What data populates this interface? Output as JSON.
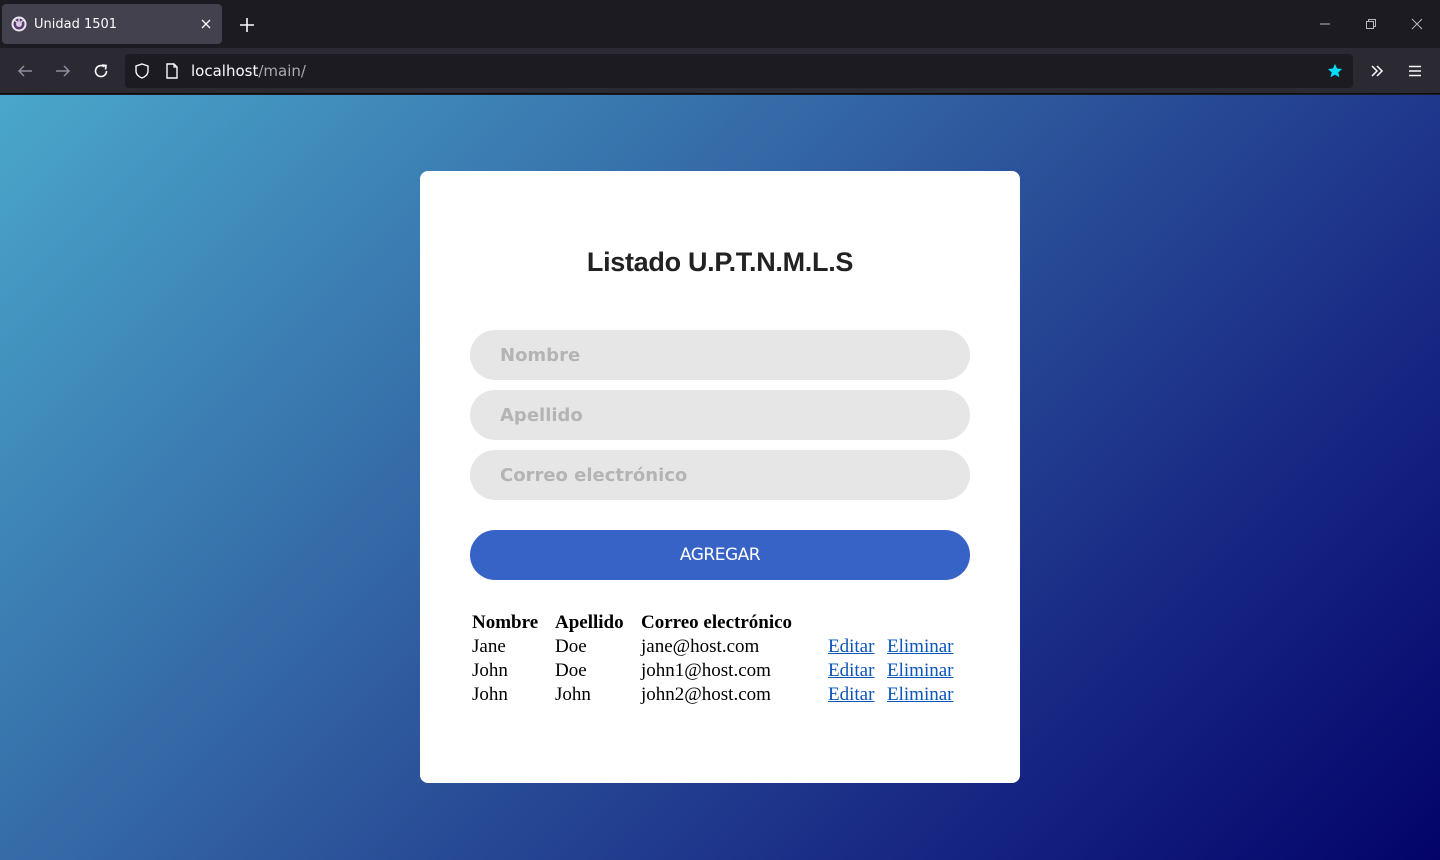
{
  "browser": {
    "tab_title": "Unidad 1501",
    "url_host": "localhost",
    "url_path": "/main/",
    "accent_star_color": "#00ddff"
  },
  "page": {
    "title": "Listado U.P.T.N.M.L.S",
    "form": {
      "name_placeholder": "Nombre",
      "surname_placeholder": "Apellido",
      "email_placeholder": "Correo electrónico",
      "add_button_label": "AGREGAR"
    },
    "table": {
      "headers": [
        "Nombre",
        "Apellido",
        "Correo electrónico"
      ],
      "rows": [
        {
          "nombre": "Jane",
          "apellido": "Doe",
          "correo": "jane@host.com",
          "edit": "Editar",
          "delete": "Eliminar"
        },
        {
          "nombre": "John",
          "apellido": "Doe",
          "correo": "john1@host.com",
          "edit": "Editar",
          "delete": "Eliminar"
        },
        {
          "nombre": "John",
          "apellido": "John",
          "correo": "john2@host.com",
          "edit": "Editar",
          "delete": "Eliminar"
        }
      ]
    },
    "colors": {
      "button": "#3763c7",
      "link": "#0a55b7",
      "gradient_start": "#4aa7cb",
      "gradient_end": "#03036a"
    }
  }
}
